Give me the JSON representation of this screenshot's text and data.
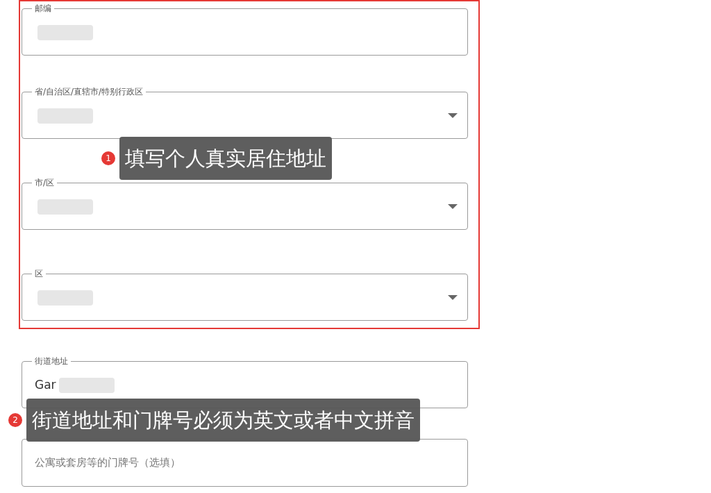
{
  "highlighted_fields": [
    {
      "kind": "text",
      "label": "邮编",
      "redacted": true
    },
    {
      "kind": "select",
      "label": "省/自治区/直辖市/特别行政区",
      "redacted": true
    },
    {
      "kind": "select",
      "label": "市/区",
      "redacted": true
    },
    {
      "kind": "select",
      "label": "区",
      "redacted": true
    }
  ],
  "fields": [
    {
      "kind": "text",
      "label": "街道地址",
      "value": "Gar",
      "redacted": true
    },
    {
      "kind": "text",
      "placeholder": "公寓或套房等的门牌号（选填）",
      "redacted": false
    }
  ],
  "annotations": [
    {
      "number": "1",
      "text": "填写个人真实居住地址"
    },
    {
      "number": "2",
      "text": "街道地址和门牌号必须为英文或者中文拼音"
    }
  ]
}
